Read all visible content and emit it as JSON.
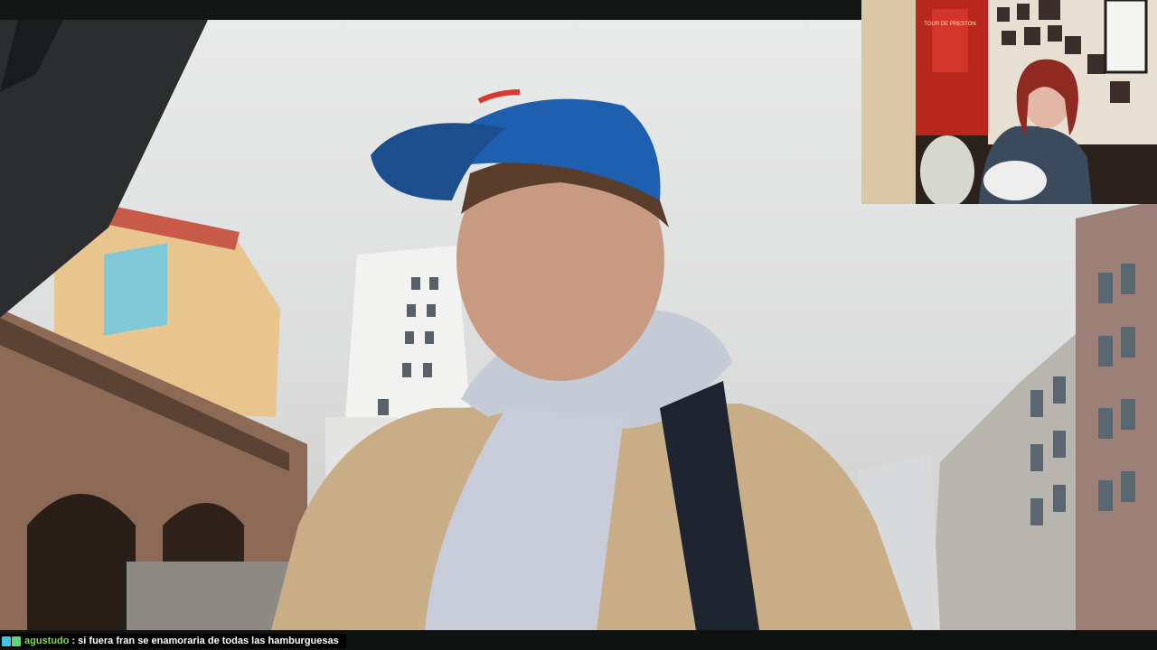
{
  "stream": {
    "chat": {
      "badges": [
        "broadcaster-icon",
        "subscriber-icon"
      ],
      "username": "agustudo",
      "separator": ":",
      "message": "si fuera fran se enamoraria de todas las hamburguesas",
      "username_color": "#7ed957"
    },
    "webcam": {
      "poster_text": "TOUR DE PRESTON"
    }
  }
}
